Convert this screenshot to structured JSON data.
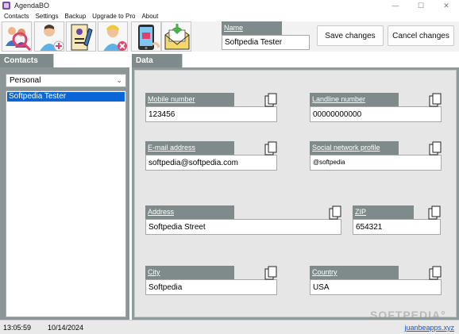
{
  "window": {
    "title": "AgendaBO",
    "controls": {
      "minimize": "—",
      "maximize": "☐",
      "close": "✕"
    }
  },
  "menu": [
    "Contacts",
    "Settings",
    "Backup",
    "Upgrade to Pro",
    "About"
  ],
  "toolbar": {
    "tools": [
      "search-contacts-icon",
      "add-contact-icon",
      "edit-contact-icon",
      "remove-contact-icon",
      "phone-icon",
      "import-envelope-icon"
    ]
  },
  "name": {
    "label": "Name",
    "value": "Softpedia Tester"
  },
  "actions": {
    "save": "Save changes",
    "cancel": "Cancel changes"
  },
  "contacts": {
    "tab_label": "Contacts",
    "group_selected": "Personal",
    "list": [
      "Softpedia Tester"
    ]
  },
  "data": {
    "tab_label": "Data",
    "mobile": {
      "label": "Mobile number",
      "value": "123456"
    },
    "landline": {
      "label": "Landline number",
      "value": "00000000000"
    },
    "email": {
      "label": "E-mail address",
      "value": "softpedia@softpedia.com"
    },
    "social": {
      "label": "Social network profile",
      "value": "@softpedia"
    },
    "address": {
      "label": "Address",
      "value": "Softpedia Street"
    },
    "zip": {
      "label": "ZIP",
      "value": "654321"
    },
    "city": {
      "label": "City",
      "value": "Softpedia"
    },
    "country": {
      "label": "Country",
      "value": "USA"
    }
  },
  "status": {
    "time": "13:05:59",
    "date": "10/14/2024",
    "link": "juanbeapps.xyz"
  },
  "watermark": "SOFTPEDIA°"
}
